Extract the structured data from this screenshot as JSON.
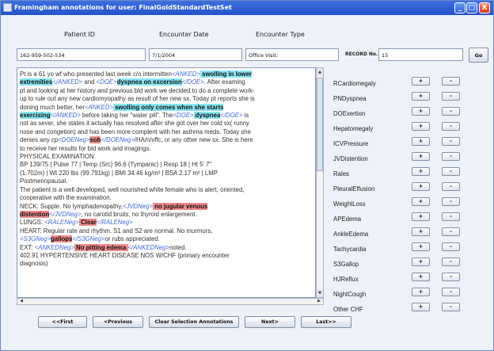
{
  "window": {
    "title": "Framingham annotations for user: FinalGoldStandardTestSet",
    "minimize": "_",
    "maximize": "□",
    "close": "X"
  },
  "headers": {
    "patient_id": "Patient ID",
    "encounter_date": "Encounter Date",
    "encounter_type": "Encounter Type"
  },
  "fields": {
    "patient_id": "162-959-502-534",
    "encounter_date": "7/1/2004",
    "encounter_type": "Office Visit:",
    "record_label": "RECORD No.",
    "record_no": "15",
    "go": "Go"
  },
  "note_lines": [
    [
      [
        "t",
        "Pt is a 61 yo wf who presented last week c/o intermitten"
      ],
      [
        "g",
        "<ANKED>"
      ],
      [
        "c",
        " swolling in lower"
      ]
    ],
    [
      [
        "c",
        "extremities"
      ],
      [
        "g",
        "</ANKED>"
      ],
      [
        "t",
        " and "
      ],
      [
        "g",
        "<DOE>"
      ],
      [
        "c",
        "dyspnea on excersion"
      ],
      [
        "g",
        "</DOE>"
      ],
      [
        "t",
        ".  After examing"
      ]
    ],
    [
      [
        "t",
        "pt and looking at her history and previous bld work we decided to do a complete work-"
      ]
    ],
    [
      [
        "t",
        "up to rule out any new cardiomyopathy as result of her new sx.  Today pt reports she is"
      ]
    ],
    [
      [
        "t",
        "doning much better, her"
      ],
      [
        "g",
        "<ANKED>"
      ],
      [
        "c",
        " swolling only comes when she starts"
      ]
    ],
    [
      [
        "c",
        "exercising"
      ],
      [
        "g",
        "</ANKED>"
      ],
      [
        "t",
        " before taking her \"water pill\".  The"
      ],
      [
        "g",
        "<DOE>"
      ],
      [
        "c",
        " dyspnea"
      ],
      [
        "g",
        "</DOE>"
      ],
      [
        "t",
        " is"
      ]
    ],
    [
      [
        "t",
        "not as sever, she states it actually has resolved after she got over her cold sx( runny"
      ]
    ],
    [
      [
        "t",
        "nose and congetion)  and has been more complent with her asthma meds.  Today she"
      ]
    ],
    [
      [
        "t",
        "denies any cp"
      ],
      [
        "g",
        "<DOENeg>"
      ],
      [
        "r",
        "sob"
      ],
      [
        "g",
        "</DOENeg>"
      ],
      [
        "t",
        "/HA/n/vffc, or any other new sx. She is here"
      ]
    ],
    [
      [
        "t",
        "to receive her results for bld work and imagings."
      ]
    ],
    [
      [
        "t",
        "PHYSICAL EXAMINATION:"
      ]
    ],
    [
      [
        "t",
        "BP 139/75 | Pulse 77 | Temp (Src) 96.6 (Tympanic) | Resp 18 | Ht 5' 7\""
      ]
    ],
    [
      [
        "t",
        "(1.702m) | Wt 220 lbs (99.791kg) | BMI 34.46 kg/m² | BSA 2.17 m² | LMP"
      ]
    ],
    [
      [
        "t",
        "Postmenopausal."
      ]
    ],
    [
      [
        "t",
        "The patient is a well developed, well nourished white female who is alert, oriented,"
      ]
    ],
    [
      [
        "t",
        "cooperative with the examination."
      ]
    ],
    [
      [
        "t",
        "NECK: Supple. No lymphadenopathy,"
      ],
      [
        "g",
        "<JVDNeg>"
      ],
      [
        "r",
        " no jugular venous"
      ]
    ],
    [
      [
        "r",
        "distention"
      ],
      [
        "g",
        "</JVDNeg>"
      ],
      [
        "t",
        ", no carotid bruits, no thyroid enlargement."
      ]
    ],
    [
      [
        "t",
        "LUNGS: "
      ],
      [
        "g",
        "<RALENeg>"
      ],
      [
        "r",
        " Clear"
      ],
      [
        "g",
        "</RALENeg>"
      ]
    ],
    [
      [
        "t",
        "HEART: Regular rate and rhythm. S1 and S2 are normal. No murmurs,"
      ]
    ],
    [
      [
        "g",
        "<S3GNeg>"
      ],
      [
        "r",
        "gallops"
      ],
      [
        "g",
        "</S3GNeg>"
      ],
      [
        "t",
        "or rubs appreciated."
      ]
    ],
    [
      [
        "t",
        "EXT: "
      ],
      [
        "g",
        "<ANKEDNeg>"
      ],
      [
        "r",
        " No pitting edema "
      ],
      [
        "g",
        "</ANKEDNeg>"
      ],
      [
        "t",
        "noted."
      ]
    ],
    [
      [
        "t",
        "402.91 HYPERTENSIVE HEART DISEASE NOS W/CHF  (primary encounter"
      ]
    ],
    [
      [
        "t",
        "diagnosis)"
      ]
    ]
  ],
  "attributes": [
    "RCardiomegaly",
    "PNDyspnea",
    "DOExertion",
    "Hepatomegaly",
    "ICVPressure",
    "JVDistention",
    "Rales",
    "PleuralEffusion",
    "WeightLoss",
    "APEdema",
    "AnkleEdema",
    "Tachycardia",
    "S3Gallop",
    "HJReflux",
    "NightCough",
    "Other CHF"
  ],
  "attribute_buttons": {
    "plus": "+",
    "minus": "-"
  },
  "nav": {
    "first": "<<First",
    "previous": "<Previous",
    "clear": "Clear Selection Annotations",
    "next": "Next>",
    "last": "Last>>"
  },
  "colors": {
    "tag": "#4169e1",
    "positive_highlight": "#87e7f3",
    "negative_highlight": "#f28c8c",
    "titlebar": "#2553c9"
  }
}
